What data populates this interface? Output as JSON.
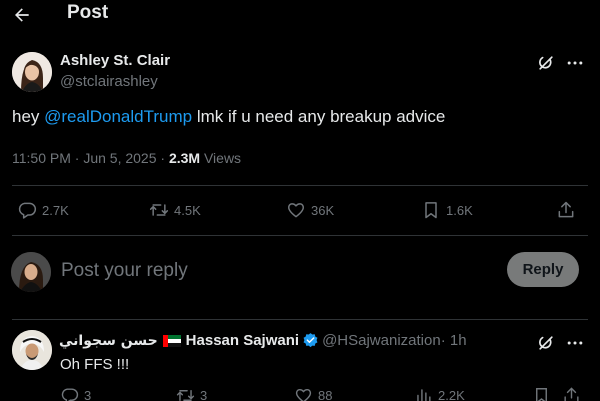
{
  "header": {
    "title": "Post",
    "back_icon": "arrow-left-icon"
  },
  "post": {
    "author_name": "Ashley St. Clair",
    "author_handle": "@stclairashley",
    "text_before": "hey ",
    "mention": "@realDonaldTrump",
    "text_after": " lmk if u need any breakup advice",
    "timestamp": "11:50 PM · Jun 5, 2025 · ",
    "views_count": "2.3M",
    "views_label": " Views",
    "stats": {
      "replies": "2.7K",
      "reposts": "4.5K",
      "likes": "36K",
      "bookmarks": "1.6K"
    }
  },
  "reply_composer": {
    "placeholder": "Post your reply",
    "button_label": "Reply"
  },
  "reply": {
    "arabic_name": "حسن سجواني",
    "name": "Hassan Sajwani",
    "handle": "@HSajwanization",
    "time": " · 1h",
    "text": "Oh FFS !!!",
    "stats": {
      "replies": "3",
      "reposts": "3",
      "likes": "88",
      "views": "2.2K"
    }
  },
  "colors": {
    "background": "#000000",
    "text": "#e7e9ea",
    "muted": "#71767b",
    "accent": "#1d9bf0",
    "divider": "#2f3336",
    "reply_button": "#787a7a"
  }
}
